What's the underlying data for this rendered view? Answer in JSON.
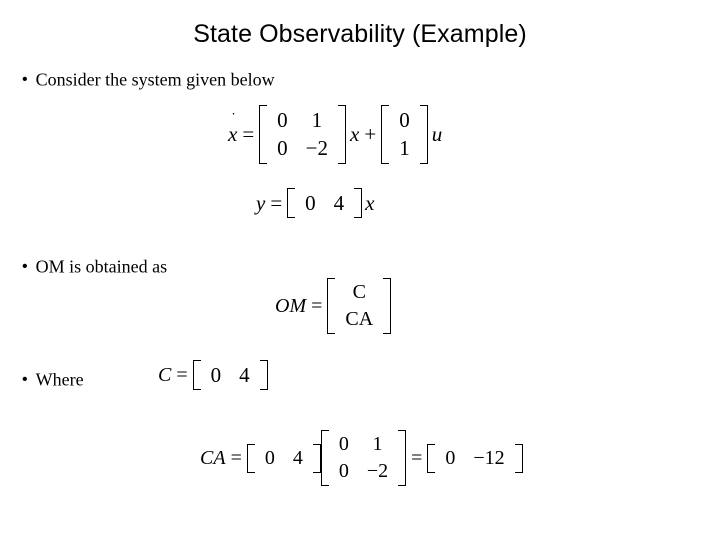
{
  "slide": {
    "title": "State Observability (Example)",
    "bullets": [
      {
        "marker": "•",
        "text": "Consider the system given below"
      },
      {
        "marker": "•",
        "text": "OM is obtained as"
      },
      {
        "marker": "•",
        "text": "Where"
      }
    ],
    "equations": {
      "state_eq": {
        "lhs": "x",
        "dot": "˙",
        "eq": "=",
        "A": {
          "rows": [
            [
              "0",
              "1"
            ],
            [
              "0",
              "−2"
            ]
          ]
        },
        "times_x": "x",
        "plus": "+",
        "B": {
          "rows": [
            [
              "0"
            ],
            [
              "1"
            ]
          ]
        },
        "times_u": "u"
      },
      "output_eq": {
        "lhs": "y",
        "eq": "=",
        "C": {
          "rows": [
            [
              "0",
              "4"
            ]
          ]
        },
        "times_x": "x"
      },
      "om_eq": {
        "lhs": "OM",
        "eq": "=",
        "matrix": {
          "rows": [
            [
              "C"
            ],
            [
              "CA"
            ]
          ]
        }
      },
      "c_eq": {
        "lhs": "C",
        "eq": "=",
        "matrix": {
          "rows": [
            [
              "0",
              "4"
            ]
          ]
        }
      },
      "ca_eq": {
        "lhs": "CA",
        "eq": "=",
        "C": {
          "rows": [
            [
              "0",
              "4"
            ]
          ]
        },
        "A": {
          "rows": [
            [
              "0",
              "1"
            ],
            [
              "0",
              "−2"
            ]
          ]
        },
        "eq2": "=",
        "result": {
          "rows": [
            [
              "0",
              "−12"
            ]
          ]
        }
      }
    }
  }
}
